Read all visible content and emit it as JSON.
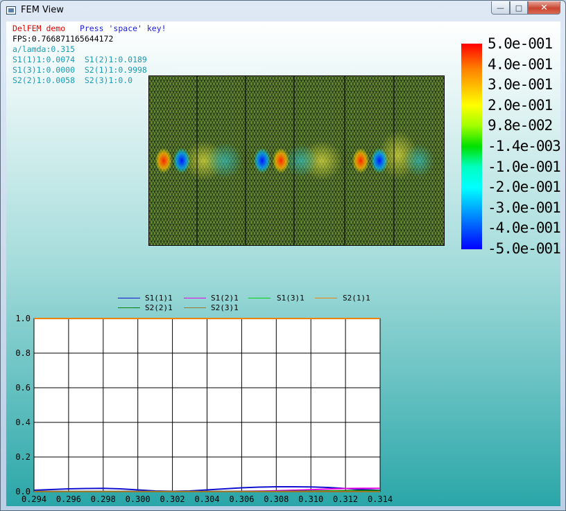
{
  "window": {
    "title": "FEM View",
    "close_glyph": "✕",
    "minimize_icon": "minimize-icon",
    "maximize_icon": "maximize-icon"
  },
  "info": {
    "demo_name": "DelFEM demo",
    "press_hint": "Press 'space' key!",
    "fps": "FPS:0.766871165644172",
    "ratio": "a/lamda:0.315",
    "s_line1": "S1(1)1:0.0074  S1(2)1:0.0189",
    "s_line2": "S1(3)1:0.0000  S2(1)1:0.9998",
    "s_line3": "S2(2)1:0.0058  S2(3)1:0.0"
  },
  "colorbar": {
    "labels": [
      "5.0e-001",
      "4.0e-001",
      "3.0e-001",
      "2.0e-001",
      "9.8e-002",
      "-1.4e-003",
      "-1.0e-001",
      "-2.0e-001",
      "-3.0e-001",
      "-4.0e-001",
      "-5.0e-001"
    ],
    "max_color": "#ff0000",
    "min_color": "#0000ff"
  },
  "chart_data": {
    "type": "line",
    "xlabel": "",
    "ylabel": "",
    "xlim": [
      0.294,
      0.314
    ],
    "ylim": [
      0.0,
      1.0
    ],
    "grid": true,
    "legend_position": "top",
    "x_ticks": [
      "0.294",
      "0.296",
      "0.298",
      "0.300",
      "0.302",
      "0.304",
      "0.306",
      "0.308",
      "0.310",
      "0.312",
      "0.314"
    ],
    "y_ticks": [
      "0.0",
      "0.2",
      "0.4",
      "0.6",
      "0.8",
      "1.0"
    ],
    "x": [
      0.294,
      0.295,
      0.296,
      0.297,
      0.298,
      0.299,
      0.3,
      0.301,
      0.302,
      0.303,
      0.304,
      0.305,
      0.306,
      0.307,
      0.308,
      0.309,
      0.31,
      0.311,
      0.312,
      0.313,
      0.314
    ],
    "series": [
      {
        "name": "S1(1)1",
        "color": "#1010d0",
        "values": [
          0.008,
          0.012,
          0.016,
          0.018,
          0.019,
          0.016,
          0.01,
          0.004,
          0.002,
          0.004,
          0.01,
          0.016,
          0.022,
          0.026,
          0.028,
          0.028,
          0.027,
          0.024,
          0.018,
          0.012,
          0.007
        ]
      },
      {
        "name": "S1(2)1",
        "color": "#e000e0",
        "values": [
          0.001,
          0.001,
          0.001,
          0.001,
          0.001,
          0.001,
          0.001,
          0.001,
          0.001,
          0.001,
          0.001,
          0.001,
          0.002,
          0.003,
          0.005,
          0.008,
          0.011,
          0.015,
          0.018,
          0.019,
          0.019
        ]
      },
      {
        "name": "S1(3)1",
        "color": "#00d000",
        "values": [
          0,
          0,
          0,
          0,
          0,
          0,
          0,
          0,
          0,
          0,
          0,
          0,
          0,
          0,
          0,
          0,
          0,
          0,
          0,
          0,
          0
        ]
      },
      {
        "name": "S2(1)1",
        "color": "#f08000",
        "values": [
          1.0,
          1.0,
          1.0,
          1.0,
          1.0,
          1.0,
          1.0,
          1.0,
          1.0,
          1.0,
          1.0,
          1.0,
          1.0,
          1.0,
          1.0,
          1.0,
          1.0,
          1.0,
          1.0,
          1.0,
          1.0
        ]
      },
      {
        "name": "S2(2)1",
        "color": "#008000",
        "values": [
          0.001,
          0.001,
          0.001,
          0.001,
          0.001,
          0.001,
          0.001,
          0.001,
          0.001,
          0.001,
          0.001,
          0.001,
          0.001,
          0.001,
          0.001,
          0.002,
          0.003,
          0.004,
          0.005,
          0.006,
          0.006
        ]
      },
      {
        "name": "S2(3)1",
        "color": "#9a7a2a",
        "values": [
          0,
          0,
          0,
          0,
          0,
          0,
          0,
          0,
          0,
          0,
          0,
          0,
          0,
          0,
          0,
          0,
          0,
          0,
          0,
          0,
          0
        ]
      }
    ]
  }
}
